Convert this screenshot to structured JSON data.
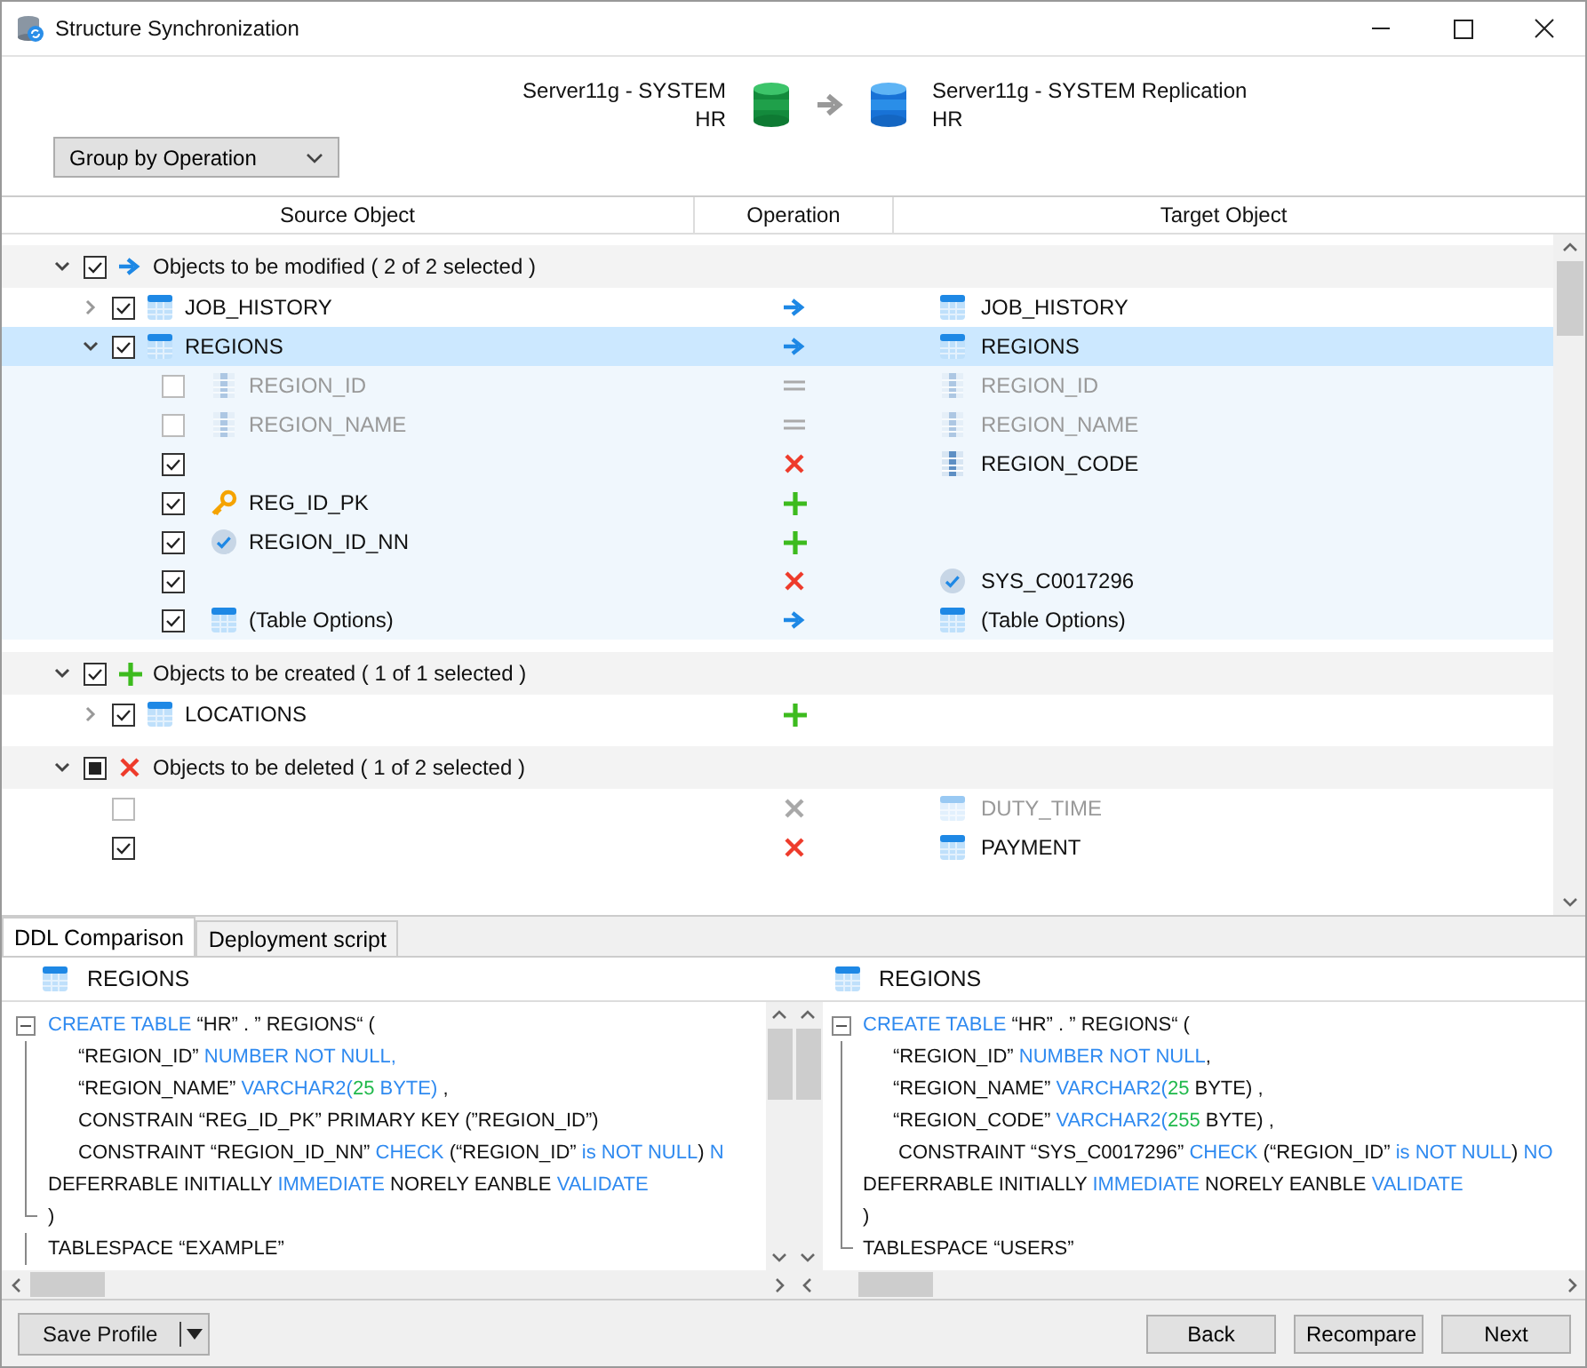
{
  "window": {
    "title": "Structure Synchronization"
  },
  "source": {
    "server": "Server11g - SYSTEM",
    "schema": "HR"
  },
  "target": {
    "server": "Server11g - SYSTEM Replication",
    "schema": "HR"
  },
  "group_by": {
    "value": "Group by Operation"
  },
  "columns": [
    "Source Object",
    "Operation",
    "Target Object"
  ],
  "groups": [
    {
      "label": "Objects to be modified ( 2 of 2 selected )",
      "kind": "modify",
      "checked": true,
      "partial": false,
      "expanded": true,
      "items": [
        {
          "source": {
            "kind": "table",
            "name": "JOB_HISTORY"
          },
          "kind": "modify",
          "target": {
            "kind": "table",
            "name": "JOB_HISTORY"
          },
          "checked": true,
          "disabled": false,
          "selected": false,
          "expanded": false
        },
        {
          "source": {
            "kind": "table",
            "name": "REGIONS"
          },
          "kind": "modify",
          "target": {
            "kind": "table",
            "name": "REGIONS"
          },
          "checked": true,
          "disabled": false,
          "selected": true,
          "expanded": true,
          "children": [
            {
              "source": {
                "kind": "column",
                "name": "REGION_ID"
              },
              "kind": "equal",
              "target": {
                "kind": "column",
                "name": "REGION_ID"
              },
              "checked": false,
              "disabled": true
            },
            {
              "source": {
                "kind": "column",
                "name": "REGION_NAME"
              },
              "kind": "equal",
              "target": {
                "kind": "column",
                "name": "REGION_NAME"
              },
              "checked": false,
              "disabled": true
            },
            {
              "kind": "delete",
              "target": {
                "kind": "column",
                "name": "REGION_CODE"
              },
              "checked": true,
              "disabled": false
            },
            {
              "source": {
                "kind": "key",
                "name": "REG_ID_PK"
              },
              "kind": "create",
              "checked": true,
              "disabled": false
            },
            {
              "source": {
                "kind": "check",
                "name": "REGION_ID_NN"
              },
              "kind": "create",
              "checked": true,
              "disabled": false
            },
            {
              "kind": "delete",
              "target": {
                "kind": "check",
                "name": "SYS_C0017296"
              },
              "checked": true,
              "disabled": false
            },
            {
              "source": {
                "kind": "table",
                "name": "(Table Options)"
              },
              "kind": "modify",
              "target": {
                "kind": "table",
                "name": "(Table Options)"
              },
              "checked": true,
              "disabled": false
            }
          ]
        }
      ]
    },
    {
      "label": "Objects to be created ( 1 of 1 selected )",
      "kind": "create",
      "checked": true,
      "partial": false,
      "expanded": true,
      "items": [
        {
          "source": {
            "kind": "table",
            "name": "LOCATIONS"
          },
          "kind": "create",
          "checked": true,
          "disabled": false,
          "selected": false,
          "expanded": false
        }
      ]
    },
    {
      "label": "Objects to be deleted ( 1 of 2 selected )",
      "kind": "delete",
      "checked": false,
      "partial": true,
      "expanded": true,
      "items": [
        {
          "kind": "delete",
          "target": {
            "kind": "table",
            "name": "DUTY_TIME"
          },
          "checked": false,
          "disabled": true,
          "selected": false
        },
        {
          "kind": "delete",
          "target": {
            "kind": "table",
            "name": "PAYMENT"
          },
          "checked": true,
          "disabled": false,
          "selected": false
        }
      ]
    }
  ],
  "tabs": [
    {
      "label": "DDL Comparison",
      "selected": true
    },
    {
      "label": "Deployment script",
      "selected": false
    }
  ],
  "panes": [
    {
      "title": "REGIONS",
      "lines": [
        {
          "kind": "outer",
          "segments": [
            {
              "kind": "keyword",
              "text": "CREATE TABLE"
            },
            {
              "kind": "text",
              "text": " “HR” . ” REGIONS“ ("
            }
          ]
        },
        {
          "kind": "inner",
          "segments": [
            {
              "kind": "text",
              "text": "“REGION_ID” "
            },
            {
              "kind": "keyword",
              "text": "NUMBER NOT NULL,"
            }
          ]
        },
        {
          "kind": "inner",
          "segments": [
            {
              "kind": "text",
              "text": "“REGION_NAME” "
            },
            {
              "kind": "keyword",
              "text": "VARCHAR2("
            },
            {
              "kind": "number",
              "text": "25"
            },
            {
              "kind": "keyword",
              "text": " BYTE)"
            },
            {
              "kind": "text",
              "text": " ,"
            }
          ]
        },
        {
          "kind": "inner",
          "segments": [
            {
              "kind": "text",
              "text": "CONSTRAIN “REG_ID_PK” PRIMARY KEY (”REGION_ID”)"
            }
          ]
        },
        {
          "kind": "inner",
          "segments": [
            {
              "kind": "text",
              "text": "CONSTRAINT “REGION_ID_NN” "
            },
            {
              "kind": "keyword",
              "text": "CHECK"
            },
            {
              "kind": "text",
              "text": " (“REGION_ID” "
            },
            {
              "kind": "keyword",
              "text": "is NOT NULL"
            },
            {
              "kind": "text",
              "text": ") "
            },
            {
              "kind": "keyword",
              "text": "N"
            }
          ]
        },
        {
          "kind": "outer",
          "segments": [
            {
              "kind": "text",
              "text": "DEFERRABLE INITIALLY "
            },
            {
              "kind": "keyword",
              "text": "IMMEDIATE"
            },
            {
              "kind": "text",
              "text": " NORELY EANBLE "
            },
            {
              "kind": "keyword",
              "text": "VALIDATE"
            }
          ]
        },
        {
          "kind": "close",
          "segments": [
            {
              "kind": "text",
              "text": ")"
            }
          ]
        },
        {
          "kind": "outer",
          "segments": [
            {
              "kind": "text",
              "text": "TABLESPACE “EXAMPLE”"
            }
          ]
        }
      ]
    },
    {
      "title": "REGIONS",
      "lines": [
        {
          "kind": "outer",
          "segments": [
            {
              "kind": "keyword",
              "text": "CREATE TABLE"
            },
            {
              "kind": "text",
              "text": " “HR” . ” REGIONS“ ("
            }
          ]
        },
        {
          "kind": "inner",
          "segments": [
            {
              "kind": "text",
              "text": "“REGION_ID” "
            },
            {
              "kind": "keyword",
              "text": "NUMBER NOT NULL"
            },
            {
              "kind": "text",
              "text": ","
            }
          ]
        },
        {
          "kind": "inner",
          "segments": [
            {
              "kind": "text",
              "text": "“REGION_NAME” "
            },
            {
              "kind": "keyword",
              "text": "VARCHAR2("
            },
            {
              "kind": "number",
              "text": "25"
            },
            {
              "kind": "text",
              "text": " BYTE) ,"
            }
          ]
        },
        {
          "kind": "inner",
          "segments": [
            {
              "kind": "text",
              "text": "“REGION_CODE” "
            },
            {
              "kind": "keyword",
              "text": "VARCHAR2("
            },
            {
              "kind": "number",
              "text": "255"
            },
            {
              "kind": "text",
              "text": " BYTE) ,"
            }
          ]
        },
        {
          "kind": "inner",
          "segments": [
            {
              "kind": "text",
              "text": " CONSTRAINT “SYS_C0017296” "
            },
            {
              "kind": "keyword",
              "text": "CHECK"
            },
            {
              "kind": "text",
              "text": " (“REGION_ID” "
            },
            {
              "kind": "keyword",
              "text": "is NOT NULL"
            },
            {
              "kind": "text",
              "text": ") "
            },
            {
              "kind": "keyword",
              "text": "NO"
            }
          ]
        },
        {
          "kind": "outer",
          "segments": [
            {
              "kind": "text",
              "text": "DEFERRABLE INITIALLY "
            },
            {
              "kind": "keyword",
              "text": "IMMEDIATE"
            },
            {
              "kind": "text",
              "text": " NORELY EANBLE "
            },
            {
              "kind": "keyword",
              "text": "VALIDATE"
            }
          ]
        },
        {
          "kind": "outer",
          "segments": [
            {
              "kind": "text",
              "text": ")"
            }
          ]
        },
        {
          "kind": "close",
          "segments": [
            {
              "kind": "text",
              "text": "TABLESPACE “USERS”"
            }
          ]
        }
      ]
    }
  ],
  "buttons": {
    "save": "Save Profile",
    "back": "Back",
    "recompare": "Recompare",
    "next": "Next"
  }
}
